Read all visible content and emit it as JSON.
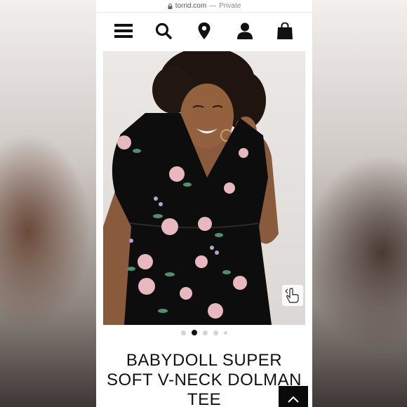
{
  "browser": {
    "domain": "torrid.com",
    "separator": "—",
    "mode": "Private"
  },
  "nav": {
    "icons": [
      "menu-icon",
      "search-icon",
      "location-pin-icon",
      "account-icon",
      "shopping-bag-icon"
    ]
  },
  "carousel": {
    "total": 5,
    "active_index": 1
  },
  "product": {
    "title_line1": "BABYDOLL SUPER",
    "title_line2": "SOFT V-NECK DOLMAN",
    "title_line3": "TEE"
  },
  "colors": {
    "dress": "#0d0d0d",
    "flower_pink": "#e7b8c0",
    "leaf_green": "#4f8f6e",
    "skin": "#8a5a3c"
  }
}
